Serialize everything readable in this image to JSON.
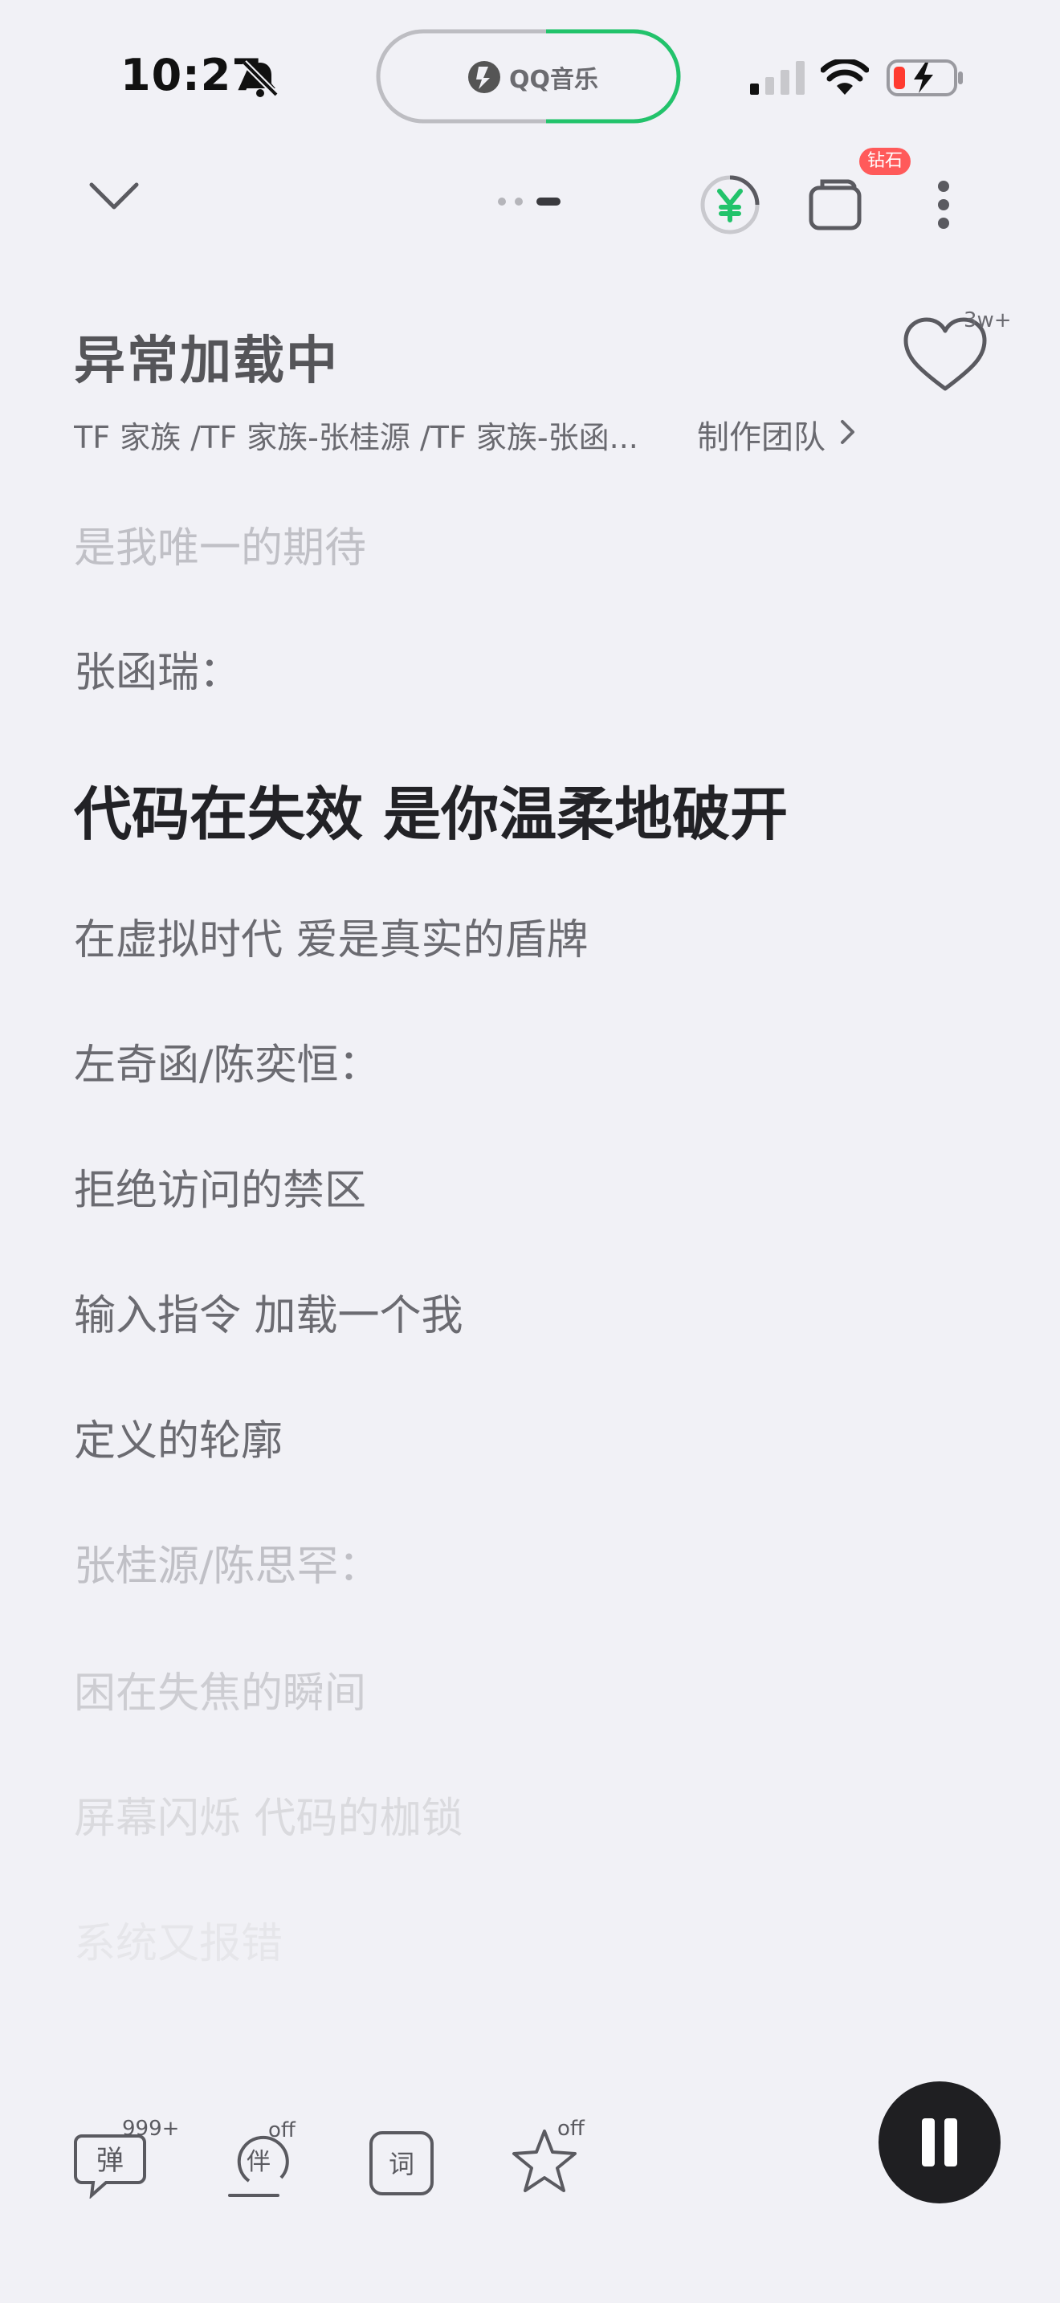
{
  "status_bar": {
    "time": "10:27",
    "island_label": "QQ音乐"
  },
  "top_bar": {
    "badge": "钻石"
  },
  "song": {
    "title": "异常加载中",
    "artist": "TF 家族 /TF 家族-张桂源 /TF 家族-张函...",
    "credits_link": "制作团队",
    "like_count": "3w+"
  },
  "lyrics": [
    {
      "text": "是我唯一的期待",
      "state": "dim1"
    },
    {
      "text": "张函瑞：",
      "state": "normal"
    },
    {
      "text": "代码在失效 是你温柔地破开",
      "state": "current"
    },
    {
      "text": "在虚拟时代 爱是真实的盾牌",
      "state": "normal"
    },
    {
      "text": "左奇函/陈奕恒：",
      "state": "normal"
    },
    {
      "text": "拒绝访问的禁区",
      "state": "normal"
    },
    {
      "text": "输入指令 加载一个我",
      "state": "normal"
    },
    {
      "text": "定义的轮廓",
      "state": "normal"
    },
    {
      "text": "张桂源/陈思罕：",
      "state": "dim1"
    },
    {
      "text": "困在失焦的瞬间",
      "state": "dim2"
    },
    {
      "text": "屏幕闪烁 代码的枷锁",
      "state": "dim3"
    },
    {
      "text": "系统又报错",
      "state": "dim4"
    }
  ],
  "controls": {
    "danmaku_label": "弹",
    "danmaku_count": "999+",
    "accompany_label": "伴",
    "accompany_state": "off",
    "lyrics_label": "词",
    "favorite_state": "off"
  }
}
